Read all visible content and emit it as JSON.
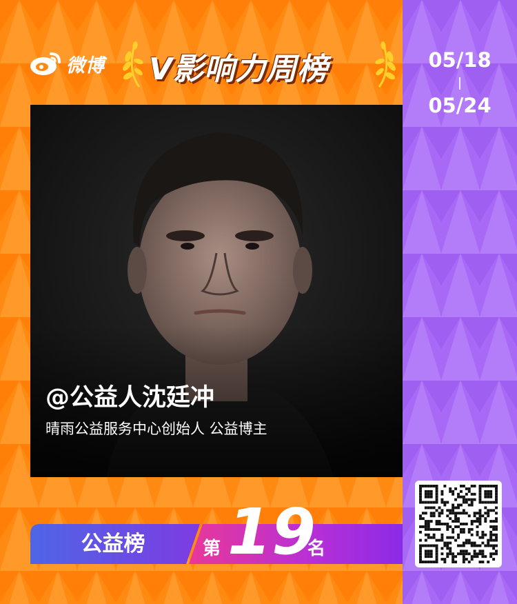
{
  "brand": {
    "logo_icon": "weibo-eye-icon",
    "name": "微博"
  },
  "title": "V影响力周榜",
  "date_range": {
    "start": "05/18",
    "end": "05/24"
  },
  "profile": {
    "handle": "@公益人沈廷冲",
    "description": "晴雨公益服务中心创始人 公益博主"
  },
  "ranking": {
    "category": "公益榜",
    "prefix": "第",
    "number": "19",
    "suffix": "名"
  },
  "qr": {
    "icon": "qr-code"
  },
  "colors": {
    "background_orange": "#FF8A12",
    "panel_purple": "#A86AF6",
    "bar_blue": "#6A4BE8",
    "bar_pink": "#E13C9B",
    "bar_purple": "#7E2BE0",
    "laurel_yellow": "#FFD02A",
    "text_white": "#FFFFFF"
  }
}
